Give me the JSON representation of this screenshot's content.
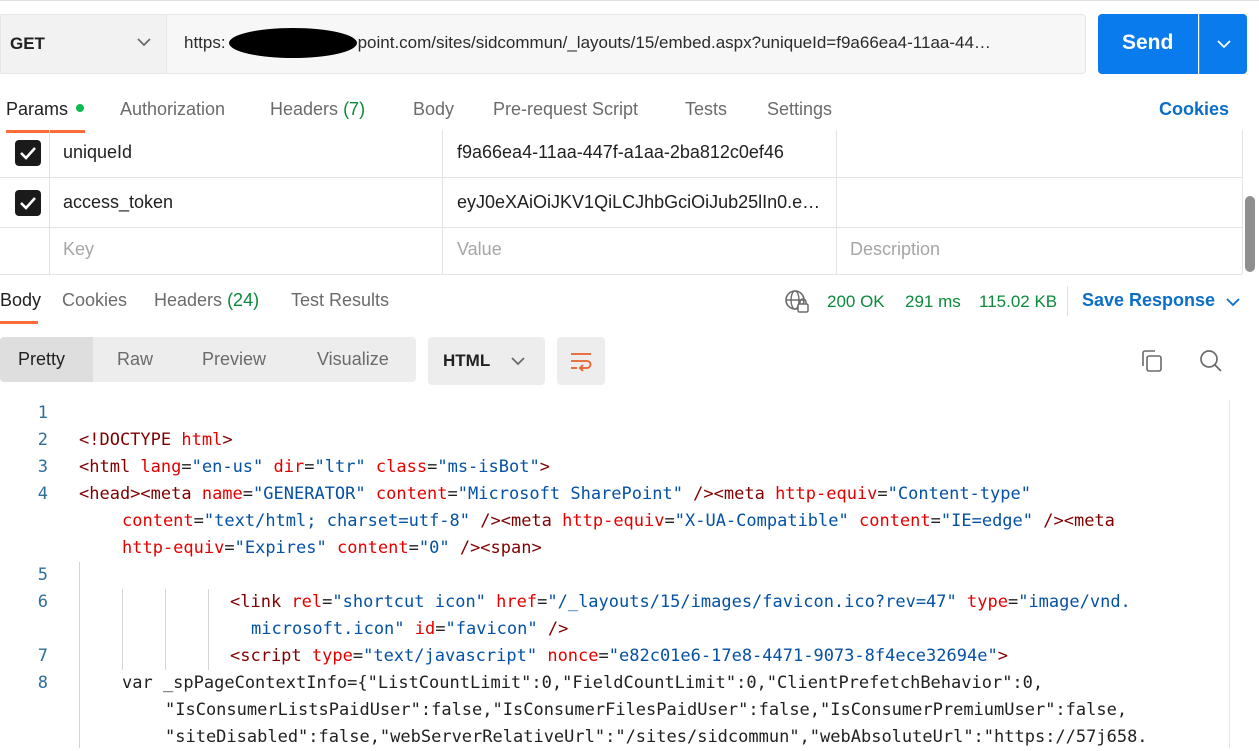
{
  "request": {
    "method": "GET",
    "url_visible_prefix": "https:",
    "url_visible_rest": "point.com/sites/sidcommun/_layouts/15/embed.aspx?uniqueId=f9a66ea4-11aa-44…",
    "send_label": "Send"
  },
  "request_tabs": {
    "params": "Params",
    "authorization": "Authorization",
    "headers": "Headers",
    "headers_count": "(7)",
    "body": "Body",
    "prerequest": "Pre-request Script",
    "tests": "Tests",
    "settings": "Settings",
    "cookies": "Cookies"
  },
  "params": {
    "rows": [
      {
        "checked": true,
        "key": "uniqueId",
        "value": "f9a66ea4-11aa-447f-a1aa-2ba812c0ef46",
        "description": ""
      },
      {
        "checked": true,
        "key": "access_token",
        "value": "eyJ0eXAiOiJKV1QiLCJhbGciOiJub25lIn0.e…",
        "description": ""
      }
    ],
    "placeholder_key": "Key",
    "placeholder_value": "Value",
    "placeholder_description": "Description"
  },
  "response": {
    "tabs": {
      "body": "Body",
      "cookies": "Cookies",
      "headers": "Headers",
      "headers_count": "(24)",
      "test_results": "Test Results"
    },
    "status": "200 OK",
    "time": "291 ms",
    "size": "115.02 KB",
    "save_response": "Save Response",
    "view_modes": [
      "Pretty",
      "Raw",
      "Preview",
      "Visualize"
    ],
    "active_view": "Pretty",
    "language": "HTML"
  },
  "colors": {
    "accent_orange": "#ff6c37",
    "send_blue": "#097bed",
    "link_blue": "#0b6ec8",
    "status_green": "#0a8a3a"
  },
  "icons": [
    "chevron-down-icon",
    "checkbox-checked-icon",
    "globe-lock-icon",
    "wrap-lines-icon",
    "copy-icon",
    "search-icon"
  ],
  "code": {
    "line_numbers": [
      "1",
      "2",
      "3",
      "4",
      "5",
      "6",
      "7",
      "8"
    ],
    "l2": {
      "a": "<!DOCTYPE ",
      "b": "html",
      "c": ">"
    },
    "l3": {
      "a": "<html ",
      "b": "lang",
      "c": "=",
      "d": "\"en-us\"",
      "e": " dir",
      "f": "=",
      "g": "\"ltr\"",
      "h": " class",
      "i": "=",
      "j": "\"ms-isBot\"",
      "k": ">"
    },
    "l4a": {
      "a": "<head><meta ",
      "b": "name",
      "c": "=",
      "d": "\"GENERATOR\"",
      "e": " content",
      "f": "=",
      "g": "\"Microsoft SharePoint\"",
      "h": " /><meta ",
      "i": "http-equiv",
      "j": "=",
      "k": "\"Content-type\""
    },
    "l4b": {
      "a": "content",
      "b": "=",
      "c": "\"text/html; charset=utf-8\"",
      "d": " /><meta ",
      "e": "http-equiv",
      "f": "=",
      "g": "\"X-UA-Compatible\"",
      "h": " content",
      "i": "=",
      "j": "\"IE=edge\"",
      "k": " /><meta"
    },
    "l4c": {
      "a": "http-equiv",
      "b": "=",
      "c": "\"Expires\"",
      "d": " content",
      "e": "=",
      "f": "\"0\"",
      "g": " /><span>"
    },
    "l6a": {
      "a": "<link ",
      "b": "rel",
      "c": "=",
      "d": "\"shortcut icon\"",
      "e": " href",
      "f": "=",
      "g": "\"/_layouts/15/images/favicon.ico?rev=47\"",
      "h": " type",
      "i": "=",
      "j": "\"image/vnd."
    },
    "l6b": {
      "a": "microsoft.icon\"",
      "b": " id",
      "c": "=",
      "d": "\"favicon\"",
      "e": " />"
    },
    "l7": {
      "a": "<script ",
      "b": "type",
      "c": "=",
      "d": "\"text/javascript\"",
      "e": " nonce",
      "f": "=",
      "g": "\"e82c01e6-17e8-4471-9073-8f4ece32694e\"",
      "h": ">"
    },
    "l8a": "var _spPageContextInfo={\"ListCountLimit\":0,\"FieldCountLimit\":0,\"ClientPrefetchBehavior\":0,",
    "l8b": "\"IsConsumerListsPaidUser\":false,\"IsConsumerFilesPaidUser\":false,\"IsConsumerPremiumUser\":false,",
    "l8c": "\"siteDisabled\":false,\"webServerRelativeUrl\":\"/sites/sidcommun\",\"webAbsoluteUrl\":\"https://57j658."
  }
}
